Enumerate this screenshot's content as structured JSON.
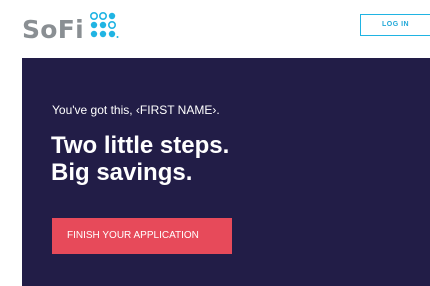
{
  "header": {
    "logo_text": "SoFi",
    "login_label": "LOG IN"
  },
  "hero": {
    "greeting": "You've got this, ‹FIRST NAME›.",
    "headline_line1": "Two little steps.",
    "headline_line2": "Big savings.",
    "cta_label": "FINISH YOUR APPLICATION"
  },
  "colors": {
    "brand_blue": "#20b4e3",
    "hero_background": "#221d47",
    "cta_red": "#e74a5a",
    "logo_gray": "#8a8f93"
  },
  "icons": [
    "sofi-logo-dots-icon"
  ]
}
